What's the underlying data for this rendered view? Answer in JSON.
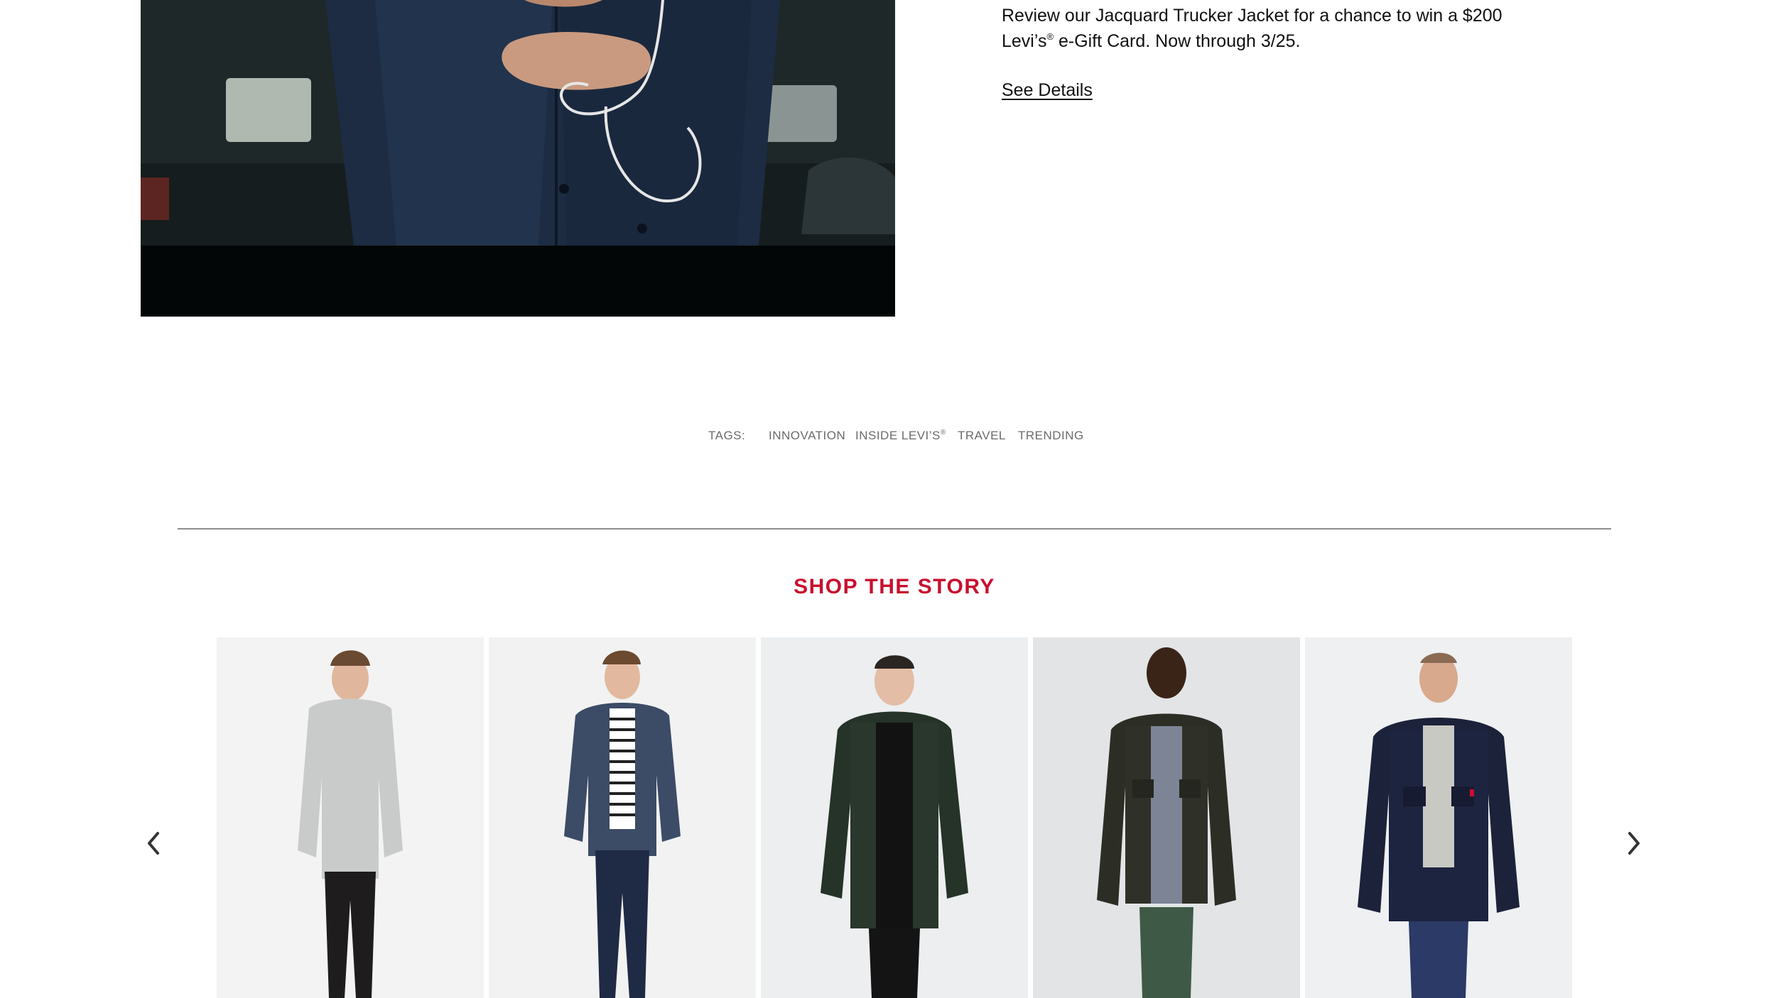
{
  "promo": {
    "line1": "Review our Jacquard Trucker Jacket for a chance to win a $200",
    "line2_brand": "Levi’s",
    "line2_reg": "®",
    "line2_rest": " e-Gift Card. Now through 3/25.",
    "see_details": "See Details"
  },
  "tags": {
    "label": "TAGS:",
    "items": [
      {
        "text": "INNOVATION"
      },
      {
        "text": "INSIDE LEVI’S",
        "sup": "®"
      },
      {
        "text": "TRAVEL"
      },
      {
        "text": "TRENDING"
      }
    ]
  },
  "shop": {
    "title": "SHOP THE STORY",
    "accent_color": "#c8102e",
    "prev_icon": "chevron-left-icon",
    "next_icon": "chevron-right-icon"
  }
}
